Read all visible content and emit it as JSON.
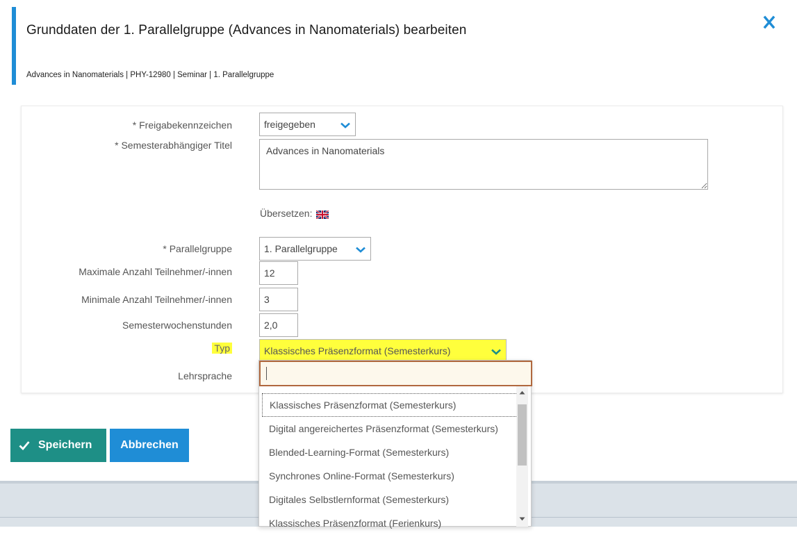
{
  "dialog": {
    "title": "Grunddaten der 1. Parallelgruppe (Advances in Nanomaterials) bearbeiten",
    "breadcrumb": "Advances in Nanomaterials | PHY-12980 | Seminar | 1. Parallelgruppe",
    "close_icon": "close-x-icon",
    "accent_color": "#1f8dd6"
  },
  "form": {
    "release": {
      "label": "* Freigabekennzeichen",
      "value": "freigegeben"
    },
    "semester_title": {
      "label": "* Semesterabhängiger Titel",
      "value": "Advances in Nanomaterials"
    },
    "translate": {
      "label": "Übersetzen:",
      "flag_icon": "uk-flag-icon"
    },
    "parallel_group": {
      "label": "* Parallelgruppe",
      "value": "1. Parallelgruppe"
    },
    "max_participants": {
      "label": "Maximale Anzahl Teilnehmer/-innen",
      "value": "12"
    },
    "min_participants": {
      "label": "Minimale Anzahl Teilnehmer/-innen",
      "value": "3"
    },
    "weekly_hours": {
      "label": "Semesterwochenstunden",
      "value": "2,0"
    },
    "type": {
      "label": "Typ",
      "value": "Klassisches Präsenzformat (Semesterkurs)",
      "highlight_color": "#ffff3c"
    },
    "language": {
      "label": "Lehrsprache"
    }
  },
  "dropdown": {
    "search_value": "",
    "options": [
      "Klassisches Präsenzformat (Semesterkurs)",
      "Digital angereichertes Präsenzformat (Semesterkurs)",
      "Blended-Learning-Format (Semesterkurs)",
      "Synchrones Online-Format (Semesterkurs)",
      "Digitales Selbstlernformat (Semesterkurs)",
      "Klassisches Präsenzformat (Ferienkurs)"
    ]
  },
  "actions": {
    "save_label": "Speichern",
    "cancel_label": "Abbrechen",
    "save_color": "#1e8f86",
    "cancel_color": "#1f8dd6"
  }
}
